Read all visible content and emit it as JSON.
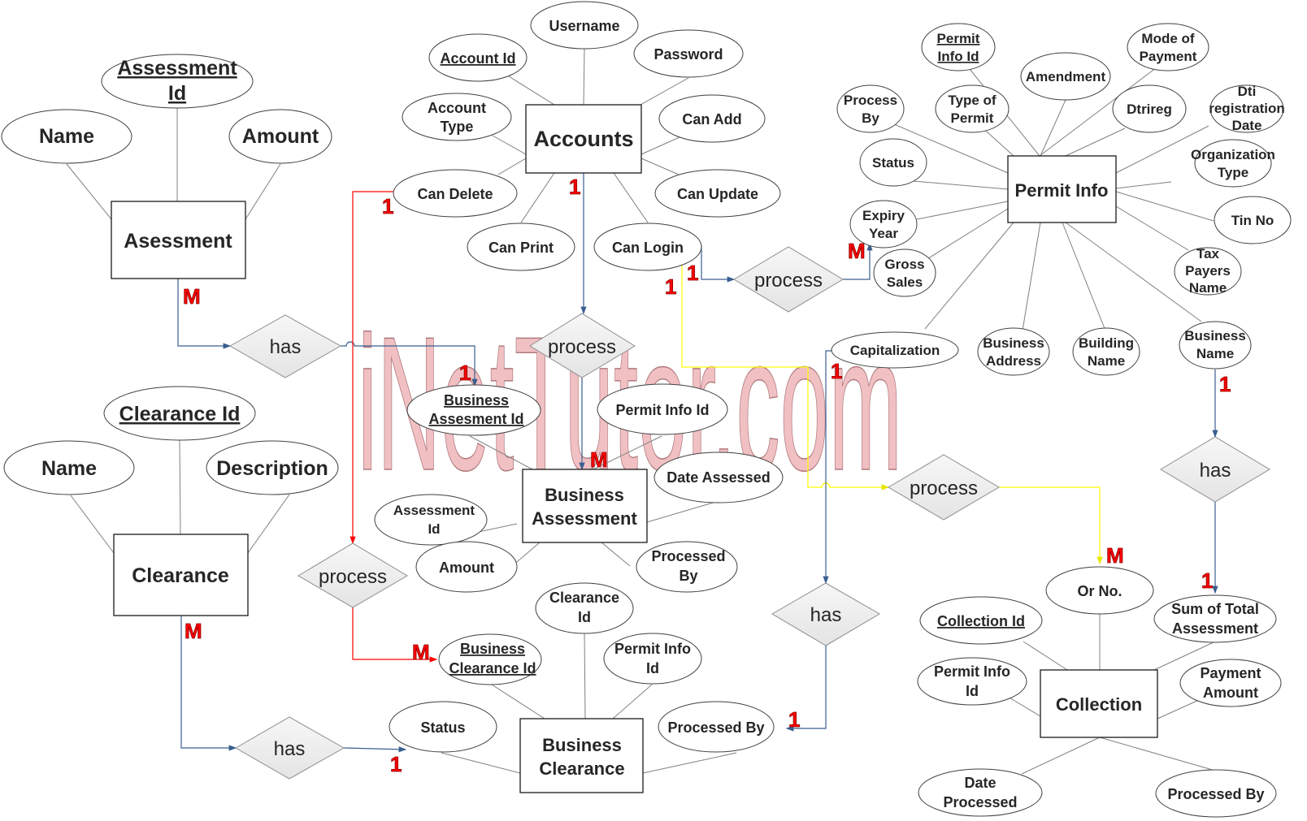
{
  "watermark": "iNetTutor.com",
  "colors": {
    "attribute_line": "#808080",
    "blue_connector": "#3a5f8f",
    "red_connector": "#ff0000",
    "yellow_connector": "#ffff00",
    "cardinality": "#ff0000",
    "relationship_fill": "#eeeeee",
    "watermark_fill": "#f0c0c3"
  },
  "entities": [
    {
      "id": "assessment",
      "label": "Asessment",
      "attributes": [
        {
          "label": "Assessment Id",
          "key": true
        },
        {
          "label": "Name",
          "key": false
        },
        {
          "label": "Amount",
          "key": false
        }
      ]
    },
    {
      "id": "accounts",
      "label": "Accounts",
      "attributes": [
        {
          "label": "Username",
          "key": false
        },
        {
          "label": "Account Id",
          "key": true
        },
        {
          "label": "Password",
          "key": false
        },
        {
          "label": "Account Type",
          "key": false
        },
        {
          "label": "Can Add",
          "key": false
        },
        {
          "label": "Can Delete",
          "key": false
        },
        {
          "label": "Can Update",
          "key": false
        },
        {
          "label": "Can Print",
          "key": false
        },
        {
          "label": "Can Login",
          "key": false
        }
      ]
    },
    {
      "id": "permit_info",
      "label": "Permit Info",
      "attributes": [
        {
          "label": "Permit Info Id",
          "key": true
        },
        {
          "label": "Mode of Payment",
          "key": false
        },
        {
          "label": "Amendment",
          "key": false
        },
        {
          "label": "Process By",
          "key": false
        },
        {
          "label": "Type of Permit",
          "key": false
        },
        {
          "label": "Dtrireg",
          "key": false
        },
        {
          "label": "Dti registration Date",
          "key": false
        },
        {
          "label": "Status",
          "key": false
        },
        {
          "label": "Organization Type",
          "key": false
        },
        {
          "label": "Expiry Year",
          "key": false
        },
        {
          "label": "Tin No",
          "key": false
        },
        {
          "label": "Gross Sales",
          "key": false
        },
        {
          "label": "Tax Payers Name",
          "key": false
        },
        {
          "label": "Capitalization",
          "key": false
        },
        {
          "label": "Business Address",
          "key": false
        },
        {
          "label": "Building Name",
          "key": false
        },
        {
          "label": "Business Name",
          "key": false
        }
      ]
    },
    {
      "id": "business_assessment",
      "label": "Business Assessment",
      "attributes": [
        {
          "label": "Business Assesment Id",
          "key": true
        },
        {
          "label": "Permit Info Id",
          "key": false
        },
        {
          "label": "Date Assessed",
          "key": false
        },
        {
          "label": "Assessment Id",
          "key": false
        },
        {
          "label": "Amount",
          "key": false
        },
        {
          "label": "Processed By",
          "key": false
        }
      ]
    },
    {
      "id": "clearance",
      "label": "Clearance",
      "attributes": [
        {
          "label": "Clearance Id",
          "key": true
        },
        {
          "label": "Name",
          "key": false
        },
        {
          "label": "Description",
          "key": false
        }
      ]
    },
    {
      "id": "business_clearance",
      "label": "Business Clearance",
      "attributes": [
        {
          "label": "Clearance Id",
          "key": false
        },
        {
          "label": "Business Clearance Id",
          "key": true
        },
        {
          "label": "Permit Info Id",
          "key": false
        },
        {
          "label": "Status",
          "key": false
        },
        {
          "label": "Processed By",
          "key": false
        }
      ]
    },
    {
      "id": "collection",
      "label": "Collection",
      "attributes": [
        {
          "label": "Or No.",
          "key": false
        },
        {
          "label": "Collection Id",
          "key": true
        },
        {
          "label": "Sum of Total Assessment",
          "key": false
        },
        {
          "label": "Permit Info Id",
          "key": false
        },
        {
          "label": "Payment Amount",
          "key": false
        },
        {
          "label": "Date Processed",
          "key": false
        },
        {
          "label": "Processed By",
          "key": false
        }
      ]
    }
  ],
  "relationships": [
    {
      "id": "rel_assessment_has",
      "label": "has",
      "from": "Asessment",
      "from_card": "M",
      "to": "Business Assesment Id",
      "to_card": "1"
    },
    {
      "id": "rel_accounts_process_ba",
      "label": "process",
      "from": "Accounts",
      "from_card": "1",
      "to": "Business Assessment",
      "to_card": "M"
    },
    {
      "id": "rel_login_process_permit",
      "label": "process",
      "from": "Can Login",
      "from_card": "1",
      "to": "Permit Info",
      "to_card": "M"
    },
    {
      "id": "rel_delete_process_bc",
      "label": "process",
      "from": "Can Delete",
      "from_card": "1",
      "to": "Business Clearance Id",
      "to_card": "M"
    },
    {
      "id": "rel_login_process_collection",
      "label": "process",
      "from": "Can Login",
      "from_card": "1",
      "to": "Or No.",
      "to_card": "M"
    },
    {
      "id": "rel_capitalization_has",
      "label": "has",
      "from": "Capitalization",
      "from_card": "1",
      "to": "Processed By",
      "to_card": "1"
    },
    {
      "id": "rel_businessname_has",
      "label": "has",
      "from": "Business Name",
      "from_card": "1",
      "to": "Sum of Total Assessment",
      "to_card": "1"
    },
    {
      "id": "rel_clearance_has",
      "label": "has",
      "from": "Clearance",
      "from_card": "M",
      "to": "Status",
      "to_card": "1"
    }
  ],
  "labels": {
    "e_assessment": "Asessment",
    "e_accounts": "Accounts",
    "e_permit": "Permit Info",
    "e_ba_1": "Business",
    "e_ba_2": "Assessment",
    "e_clearance": "Clearance",
    "e_bc_1": "Business",
    "e_bc_2": "Clearance",
    "e_collection": "Collection",
    "a_assess_id_1": "Assessment",
    "a_assess_id_2": "Id",
    "a_assess_name": "Name",
    "a_assess_amount": "Amount",
    "a_username": "Username",
    "a_account_id": "Account Id",
    "a_password": "Password",
    "a_account_type_1": "Account",
    "a_account_type_2": "Type",
    "a_can_add": "Can Add",
    "a_can_delete": "Can Delete",
    "a_can_update": "Can Update",
    "a_can_print": "Can Print",
    "a_can_login": "Can Login",
    "a_permit_id_1": "Permit",
    "a_permit_id_2": "Info Id",
    "a_mode_pay_1": "Mode of",
    "a_mode_pay_2": "Payment",
    "a_amendment": "Amendment",
    "a_process_by_1": "Process",
    "a_process_by_2": "By",
    "a_type_permit_1": "Type of",
    "a_type_permit_2": "Permit",
    "a_dtrireg": "Dtrireg",
    "a_dti_1": "Dti",
    "a_dti_2": "registration",
    "a_dti_3": "Date",
    "a_p_status": "Status",
    "a_org_1": "Organization",
    "a_org_2": "Type",
    "a_expiry_1": "Expiry",
    "a_expiry_2": "Year",
    "a_tin": "Tin No",
    "a_gross_1": "Gross",
    "a_gross_2": "Sales",
    "a_tax_1": "Tax",
    "a_tax_2": "Payers",
    "a_tax_3": "Name",
    "a_capital": "Capitalization",
    "a_baddr_1": "Business",
    "a_baddr_2": "Address",
    "a_bldg_1": "Building",
    "a_bldg_2": "Name",
    "a_bname_1": "Business",
    "a_bname_2": "Name",
    "a_baid_1": "Business",
    "a_baid_2": "Assesment Id",
    "a_ba_permit": "Permit Info Id",
    "a_date_assessed": "Date Assessed",
    "a_ba_assess_1": "Assessment",
    "a_ba_assess_2": "Id",
    "a_ba_amount": "Amount",
    "a_ba_proc_1": "Processed",
    "a_ba_proc_2": "By",
    "a_cl_id": "Clearance Id",
    "a_cl_name": "Name",
    "a_cl_desc": "Description",
    "a_bc_clid_1": "Clearance",
    "a_bc_clid_2": "Id",
    "a_bcid_1": "Business",
    "a_bcid_2": "Clearance Id",
    "a_bc_permit_1": "Permit Info",
    "a_bc_permit_2": "Id",
    "a_bc_status": "Status",
    "a_bc_proc": "Processed By",
    "a_orno": "Or No.",
    "a_col_id": "Collection Id",
    "a_sum_1": "Sum of Total",
    "a_sum_2": "Assessment",
    "a_col_permit_1": "Permit Info",
    "a_col_permit_2": "Id",
    "a_payamt_1": "Payment",
    "a_payamt_2": "Amount",
    "a_datep_1": "Date",
    "a_datep_2": "Processed",
    "a_col_proc": "Processed By",
    "r_has": "has",
    "r_process": "process",
    "c_one": "1",
    "c_many": "M"
  }
}
